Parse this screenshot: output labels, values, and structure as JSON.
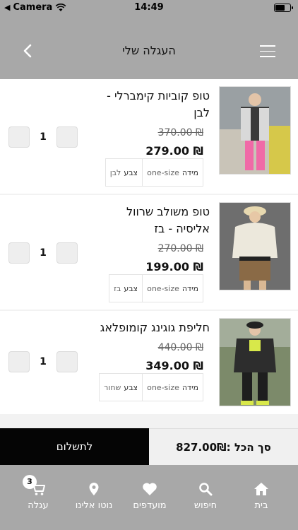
{
  "status": {
    "carrier": "Camera",
    "time": "14:49"
  },
  "header": {
    "title": "העגלה שלי"
  },
  "items": [
    {
      "name": "טופ קוביות קימברלי - לבן",
      "old_price": "370.00 ₪",
      "price": "279.00 ₪",
      "size_label": "מידה",
      "size_value": "one-size",
      "color_label": "צבע",
      "color_value": "לבן",
      "qty": "1"
    },
    {
      "name": "טופ משולב שרוול אליסיה - בז",
      "old_price": "270.00 ₪",
      "price": "199.00 ₪",
      "size_label": "מידה",
      "size_value": "one-size",
      "color_label": "צבע",
      "color_value": "בז",
      "qty": "1"
    },
    {
      "name": "חליפת גוגינג קומופלאג",
      "old_price": "440.00 ₪",
      "price": "349.00 ₪",
      "size_label": "מידה",
      "size_value": "one-size",
      "color_label": "צבע",
      "color_value": "שחור",
      "qty": "1"
    }
  ],
  "footer": {
    "checkout_label": "לתשלום",
    "total_label": "סך הכל :827.00₪"
  },
  "tabbar": {
    "cart_badge": "3",
    "tabs": [
      "עגלה",
      "נוטו אלינו",
      "מועדפים",
      "חיפוש",
      "בית"
    ]
  }
}
